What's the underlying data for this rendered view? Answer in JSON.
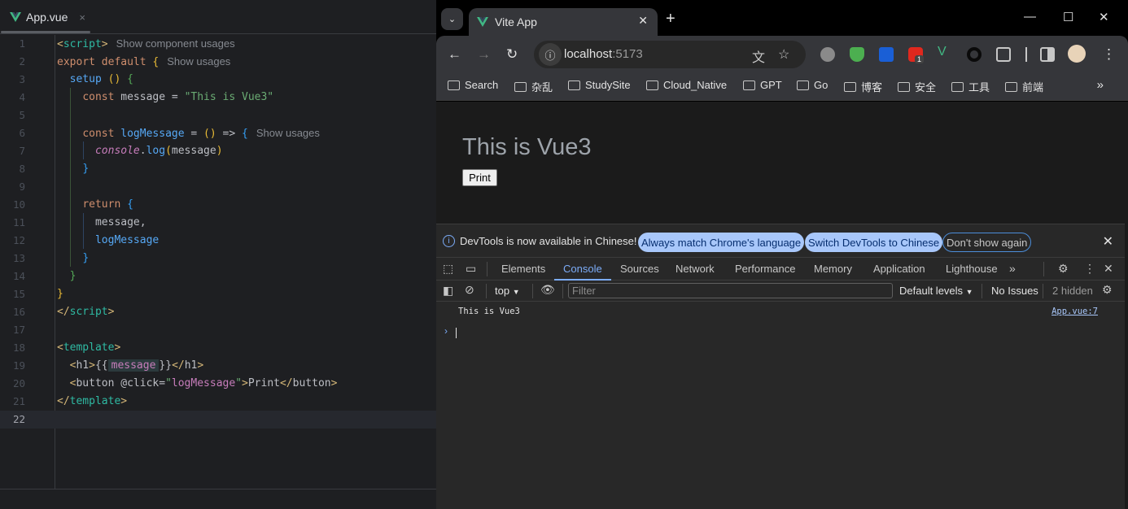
{
  "editor": {
    "tab": {
      "filename": "App.vue",
      "icon": "vue-logo-icon",
      "close": "×"
    },
    "line_numbers": [
      "1",
      "2",
      "3",
      "4",
      "5",
      "6",
      "7",
      "8",
      "9",
      "10",
      "11",
      "12",
      "13",
      "14",
      "15",
      "16",
      "17",
      "18",
      "19",
      "20",
      "21",
      "22"
    ],
    "hints": {
      "component_usages": "Show component usages",
      "usages": "Show usages"
    },
    "tokens": {
      "script_open": "script",
      "export": "export",
      "default": "default",
      "setup": "setup",
      "const": "const",
      "message": "message",
      "eq": "=",
      "message_value": "\"This is Vue3\"",
      "logMessage": "logMessage",
      "arrow": "=>",
      "console": "console",
      "log": "log",
      "return": "return",
      "message_comma": "message,",
      "template": "template",
      "h1": "h1",
      "button": "button",
      "click_attr": "@click",
      "click_value": "logMessage",
      "print_text": "Print"
    },
    "current_line": "22"
  },
  "browser": {
    "tab_title": "Vite App",
    "new_tab": "+",
    "url_host": "localhost",
    "url_port": ":5173",
    "extension_badge": "1",
    "bookmarks": [
      "Search",
      "杂乱",
      "StudySite",
      "Cloud_Native",
      "GPT",
      "Go",
      "博客",
      "安全",
      "工具",
      "前端"
    ],
    "bookmarks_more": "»",
    "page": {
      "heading": "This is Vue3",
      "button_label": "Print"
    },
    "devtools": {
      "infobar": {
        "message": "DevTools is now available in Chinese!",
        "btn_match": "Always match Chrome's language",
        "btn_switch": "Switch DevTools to Chinese",
        "btn_dont_show": "Don't show again"
      },
      "tabs": [
        "Elements",
        "Console",
        "Sources",
        "Network",
        "Performance",
        "Memory",
        "Application",
        "Lighthouse"
      ],
      "active_tab": "Console",
      "console_bar": {
        "context": "top",
        "filter_placeholder": "Filter",
        "levels": "Default levels",
        "issues": "No Issues",
        "hidden": "2 hidden"
      },
      "logs": [
        {
          "message": "This is Vue3",
          "source": "App.vue:7"
        }
      ]
    }
  }
}
